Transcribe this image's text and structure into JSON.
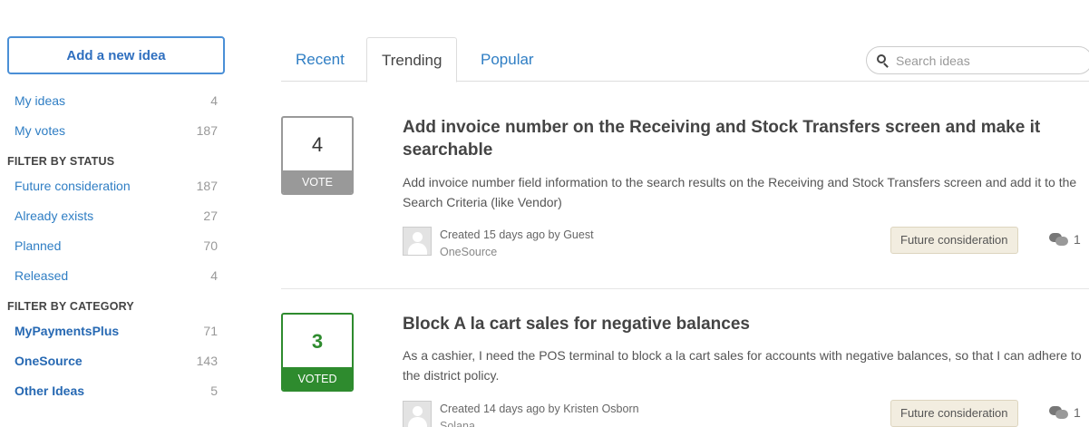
{
  "sidebar": {
    "add_button": "Add a new idea",
    "personal": [
      {
        "label": "My ideas",
        "count": "4"
      },
      {
        "label": "My votes",
        "count": "187"
      }
    ],
    "status_heading": "FILTER BY STATUS",
    "statuses": [
      {
        "label": "Future consideration",
        "count": "187"
      },
      {
        "label": "Already exists",
        "count": "27"
      },
      {
        "label": "Planned",
        "count": "70"
      },
      {
        "label": "Released",
        "count": "4"
      }
    ],
    "category_heading": "FILTER BY CATEGORY",
    "categories": [
      {
        "label": "MyPaymentsPlus",
        "count": "71"
      },
      {
        "label": "OneSource",
        "count": "143"
      },
      {
        "label": "Other Ideas",
        "count": "5"
      }
    ]
  },
  "tabs": [
    {
      "label": "Recent"
    },
    {
      "label": "Trending"
    },
    {
      "label": "Popular"
    }
  ],
  "search": {
    "placeholder": "Search ideas"
  },
  "ideas": [
    {
      "votes": "4",
      "vote_label": "VOTE",
      "title": "Add invoice number on the Receiving and Stock Transfers screen and make it searchable",
      "description": "Add invoice number field information to the search results on the Receiving and Stock Transfers screen and add it to the Search Criteria (like Vendor)",
      "created": "Created 15 days ago by Guest",
      "org": "OneSource",
      "status": "Future consideration",
      "comments": "1"
    },
    {
      "votes": "3",
      "vote_label": "VOTED",
      "title": "Block A la cart sales for negative balances",
      "description": "As a cashier, I need the POS terminal to block a la cart sales for accounts with negative balances, so that I can adhere to the district policy.",
      "created": "Created 14 days ago by Kristen Osborn",
      "org": "Solana",
      "status": "Future consideration",
      "comments": "1"
    }
  ],
  "colors": {
    "accent": "#2f7ec4",
    "voted": "#2e8b2e",
    "vote_gray": "#999999",
    "badge_bg": "#f2ede0"
  }
}
